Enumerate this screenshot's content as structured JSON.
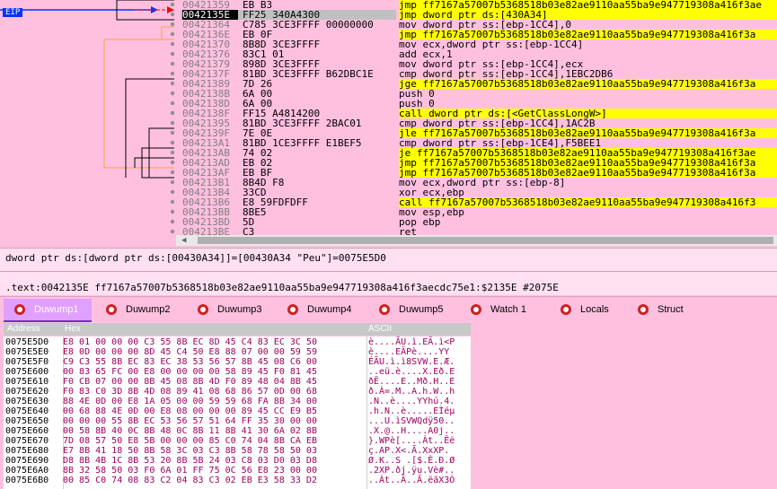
{
  "disasm": {
    "eip_label": "EIP",
    "rows": [
      {
        "addr": "00421359",
        "bytes": "EB B3",
        "instr": "jmp ff7167a57007b5368518b03e82ae9110aa55ba9e947719308a416f3ae",
        "kind": "jmp"
      },
      {
        "addr": "0042135E",
        "bytes": "FF25 340A4300",
        "instr": "jmp dword ptr ds:[430A34]",
        "kind": "jmp"
      },
      {
        "addr": "00421364",
        "bytes": "C785 3CE3FFFF 00000000",
        "instr": "mov dword ptr ss:[ebp-1CC4],0",
        "kind": "plain"
      },
      {
        "addr": "0042136E",
        "bytes": "EB 0F",
        "instr": "jmp ff7167a57007b5368518b03e82ae9110aa55ba9e947719308a416f3a",
        "kind": "jmp"
      },
      {
        "addr": "00421370",
        "bytes": "8B8D 3CE3FFFF",
        "instr": "mov ecx,dword ptr ss:[ebp-1CC4]",
        "kind": "plain"
      },
      {
        "addr": "00421376",
        "bytes": "83C1 01",
        "instr": "add ecx,1",
        "kind": "plain"
      },
      {
        "addr": "00421379",
        "bytes": "898D 3CE3FFFF",
        "instr": "mov dword ptr ss:[ebp-1CC4],ecx",
        "kind": "plain"
      },
      {
        "addr": "0042137F",
        "bytes": "81BD 3CE3FFFF B62DBC1E",
        "instr": "cmp dword ptr ss:[ebp-1CC4],1EBC2DB6",
        "kind": "plain"
      },
      {
        "addr": "00421389",
        "bytes": "7D 26",
        "instr": "jge ff7167a57007b5368518b03e82ae9110aa55ba9e947719308a416f3a",
        "kind": "jmp"
      },
      {
        "addr": "0042138B",
        "bytes": "6A 00",
        "instr": "push 0",
        "kind": "plain"
      },
      {
        "addr": "0042138D",
        "bytes": "6A 00",
        "instr": "push 0",
        "kind": "plain"
      },
      {
        "addr": "0042138F",
        "bytes": "FF15 A4814200",
        "instr": "call dword ptr ds:[<GetClassLongW>]",
        "kind": "call"
      },
      {
        "addr": "00421395",
        "bytes": "81BD 3CE3FFFF 2BAC01",
        "instr": "cmp dword ptr ss:[ebp-1CC4],1AC2B",
        "kind": "plain"
      },
      {
        "addr": "0042139F",
        "bytes": "7E 0E",
        "instr": "jle ff7167a57007b5368518b03e82ae9110aa55ba9e947719308a416f3a",
        "kind": "jmp"
      },
      {
        "addr": "004213A1",
        "bytes": "81BD 1CE3FFFF E1BEF5",
        "instr": "cmp dword ptr ss:[ebp-1CE4],F5BEE1",
        "kind": "plain"
      },
      {
        "addr": "004213AB",
        "bytes": "74 02",
        "instr": "je ff7167a57007b5368518b03e82ae9110aa55ba9e947719308a416f3ae",
        "kind": "jmp"
      },
      {
        "addr": "004213AD",
        "bytes": "EB 02",
        "instr": "jmp ff7167a57007b5368518b03e82ae9110aa55ba9e947719308a416f3a",
        "kind": "jmp"
      },
      {
        "addr": "004213AF",
        "bytes": "EB BF",
        "instr": "jmp ff7167a57007b5368518b03e82ae9110aa55ba9e947719308a416f3a",
        "kind": "jmp"
      },
      {
        "addr": "004213B1",
        "bytes": "8B4D F8",
        "instr": "mov ecx,dword ptr ss:[ebp-8]",
        "kind": "plain"
      },
      {
        "addr": "004213B4",
        "bytes": "33CD",
        "instr": "xor ecx,ebp",
        "kind": "plain"
      },
      {
        "addr": "004213B6",
        "bytes": "E8 59FDFDFF",
        "instr": "call ff7167a57007b5368518b03e82ae9110aa55ba9e947719308a416f3",
        "kind": "call"
      },
      {
        "addr": "004213BB",
        "bytes": "8BE5",
        "instr": "mov esp,ebp",
        "kind": "plain"
      },
      {
        "addr": "004213BD",
        "bytes": "5D",
        "instr": "pop ebp",
        "kind": "plain"
      },
      {
        "addr": "004213BE",
        "bytes": "C3",
        "instr": "ret",
        "kind": "plain"
      }
    ]
  },
  "info": {
    "line1": "dword ptr ds:[dword ptr ds:[00430A34]]=[00430A34 \"Peu\"]=0075E5D0",
    "line2": ".text:0042135E ff7167a57007b5368518b03e82ae9110aa55ba9e947719308a416f3aecdc75e1:$2135E #2075E"
  },
  "tabs": [
    "Duwump1",
    "Duwump2",
    "Duwump3",
    "Duwump4",
    "Duwump5",
    "Watch 1",
    "Locals",
    "Struct"
  ],
  "dump": {
    "headers": {
      "address": "Address",
      "hex": "Hex",
      "ascii": "ASCII"
    },
    "rows": [
      {
        "addr": "0075E5D0",
        "hex": "E8 01 00 00 00 C3 55 8B EC 8D 45 C4 83 EC 3C 50",
        "ascii": "è....ÃU.ì.EÄ.ì<P"
      },
      {
        "addr": "0075E5E0",
        "hex": "E8 0D 00 00 00 8D 45 C4 50 E8 88 07 00 00 59 59",
        "ascii": "è....EÄPè....YY"
      },
      {
        "addr": "0075E5F0",
        "hex": "C9 C3 55 8B EC 83 EC 38 53 56 57 8B 45 08 C6 00",
        "ascii": "ÉÃU.ì.ì8SVW.E.Æ."
      },
      {
        "addr": "0075E600",
        "hex": "00 83 65 FC 00 E8 00 00 00 00 58 89 45 F0 81 45",
        "ascii": "..eü.è....X.Eð.E"
      },
      {
        "addr": "0075E610",
        "hex": "F0 CB 07 00 00 8B 45 08 8B 4D F0 89 48 04 8B 45",
        "ascii": "ðË....E..Mð.H..E"
      },
      {
        "addr": "0075E620",
        "hex": "F0 83 C0 3D 8B 4D 08 89 41 08 68 86 57 0D 00 68",
        "ascii": "ð.À=.M..A.h.W..h"
      },
      {
        "addr": "0075E630",
        "hex": "88 4E 0D 00 E8 1A 05 00 00 59 59 68 FA 8B 34 00",
        "ascii": ".N..è....YYhú.4."
      },
      {
        "addr": "0075E640",
        "hex": "00 68 88 4E 0D 00 E8 08 00 00 00 89 45 CC E9 B5",
        "ascii": ".h.N..è.....EÌéµ"
      },
      {
        "addr": "0075E650",
        "hex": "00 00 00 55 8B EC 53 56 57 51 64 FF 35 30 00 00",
        "ascii": "...U.ìSVWQdÿ50.."
      },
      {
        "addr": "0075E660",
        "hex": "00 58 8B 40 0C 8B 48 0C 8B 11 8B 41 30 6A 02 8B",
        "ascii": ".X.@..H....A0j.."
      },
      {
        "addr": "0075E670",
        "hex": "7D 08 57 50 E8 5B 00 00 00 85 C0 74 04 8B CA EB",
        "ascii": "}.WPè[....Àt..Êë"
      },
      {
        "addr": "0075E680",
        "hex": "E7 8B 41 18 50 8B 58 3C 03 C3 8B 58 78 58 50 03",
        "ascii": "ç.AP.X<.Ã.XxXP."
      },
      {
        "addr": "0075E690",
        "hex": "D8 8B 4B 1C 8B 53 20 8B 5B 24 03 C8 03 D0 03 D8",
        "ascii": "Ø.K..S .[$.È.Ð.Ø"
      },
      {
        "addr": "0075E6A0",
        "hex": "8B 32 58 50 03 F0 6A 01 FF 75 0C 56 E8 23 00 00",
        "ascii": ".2XP.ðj.ÿu.Vè#.."
      },
      {
        "addr": "0075E6B0",
        "hex": "00 85 C0 74 08 83 C2 04 83 C3 02 EB E3 58 33 D2",
        "ascii": "..Àt..Â..Ã.ëãX3Ò"
      }
    ]
  },
  "colors": {
    "background": "#ffc0e0",
    "highlight": "#ffff00",
    "register": "#00ffff",
    "eip_arrow": "#0033ff",
    "jump_arrow_red": "#ff0000",
    "jump_arrow_orange": "#ffa040"
  }
}
